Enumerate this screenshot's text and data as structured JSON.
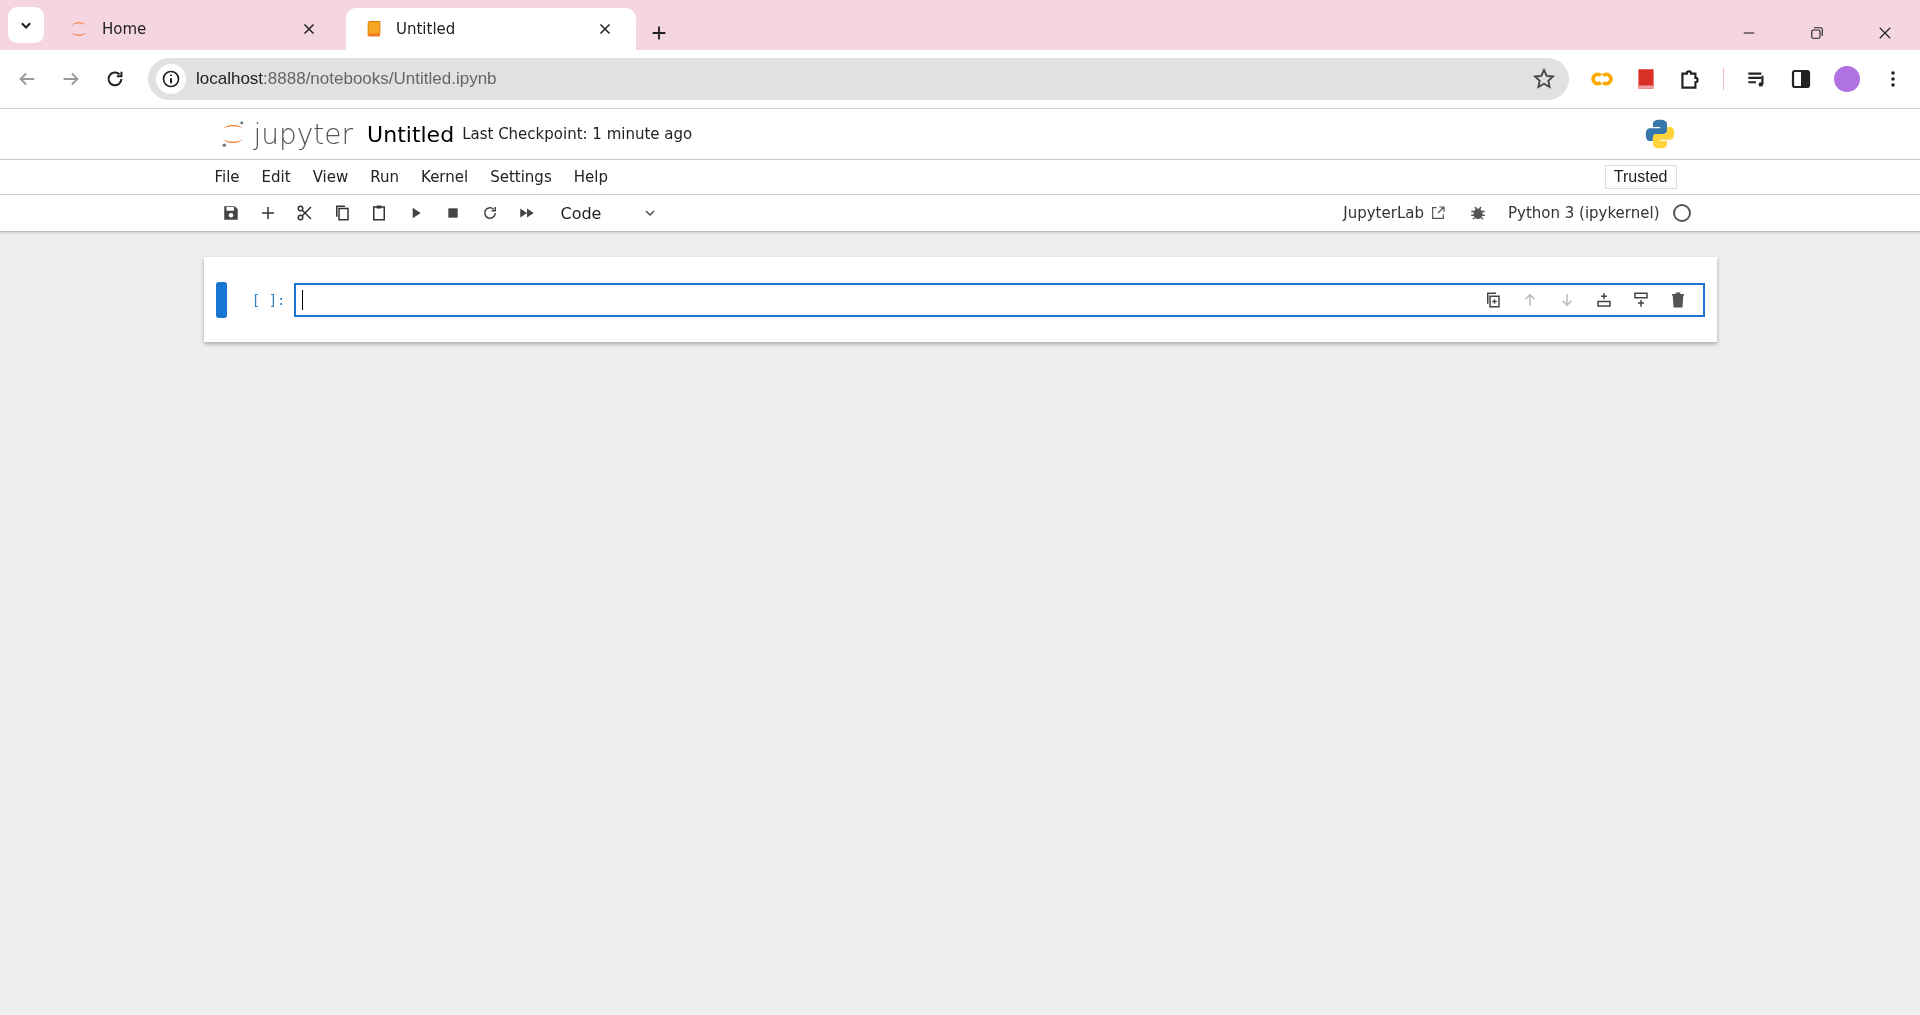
{
  "browser": {
    "tabs": [
      {
        "title": "Home",
        "kind": "jupyter",
        "selected": false
      },
      {
        "title": "Untitled",
        "kind": "notebook",
        "selected": true
      }
    ],
    "url_host": "localhost",
    "url_path": ":8888/notebooks/Untitled.ipynb"
  },
  "notebook": {
    "logo_text": "jupyter",
    "title": "Untitled",
    "checkpoint": "Last Checkpoint: 1 minute ago"
  },
  "menu": [
    "File",
    "Edit",
    "View",
    "Run",
    "Kernel",
    "Settings",
    "Help"
  ],
  "trusted": "Trusted",
  "toolbar": {
    "cell_type": "Code",
    "jupyterlab_link": "JupyterLab",
    "kernel": "Python 3 (ipykernel)",
    "kernel_busy": false
  },
  "cells": [
    {
      "prompt": "[ ]:",
      "selected": true
    }
  ]
}
